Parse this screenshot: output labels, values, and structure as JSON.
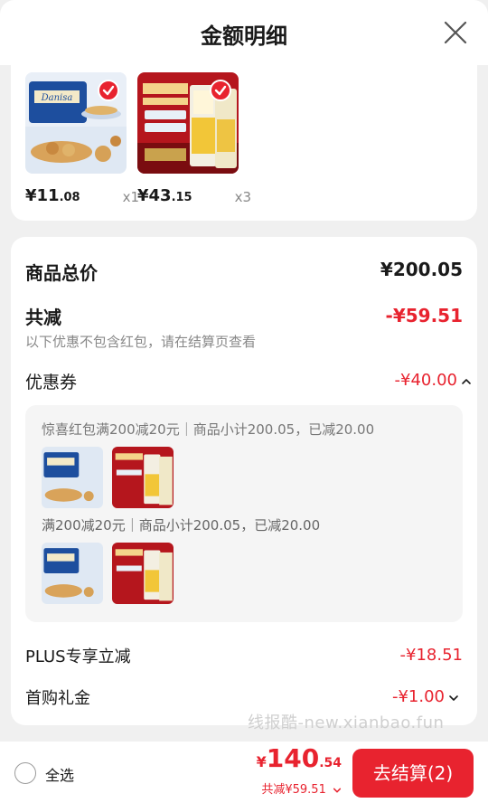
{
  "header": {
    "title": "金额明细"
  },
  "products": [
    {
      "price_int": "¥11",
      "price_dec": ".08",
      "qty": "x1",
      "icon": "danisa-cookies-image"
    },
    {
      "price_int": "¥43",
      "price_dec": ".15",
      "qty": "x3",
      "icon": "rice-bag-image"
    }
  ],
  "summary": {
    "total_label": "商品总价",
    "total_value": "¥200.05",
    "reduce_label": "共减",
    "reduce_value": "-¥59.51",
    "reduce_note": "以下优惠不包含红包，请在结算页查看",
    "coupon_label": "优惠券",
    "coupon_value": "-¥40.00",
    "coupon_lines": [
      "惊喜红包满200减20元｜商品小计200.05，已减20.00",
      "满200减20元｜商品小计200.05，已减20.00"
    ],
    "plus_label": "PLUS专享立减",
    "plus_value": "-¥18.51",
    "first_label": "首购礼金",
    "first_value": "-¥1.00"
  },
  "watermark": "线报酷-new.xianbao.fun",
  "bottom": {
    "select_all": "全选",
    "currency": "¥",
    "total_int": "140",
    "total_dec": ".54",
    "saved": "共减¥59.51",
    "checkout": "去结算(2)"
  },
  "colors": {
    "accent": "#e8232f",
    "background": "#f0f0f0",
    "card": "#ffffff"
  }
}
